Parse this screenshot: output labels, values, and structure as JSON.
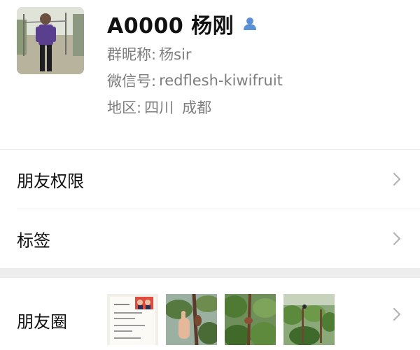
{
  "profile": {
    "display_name": "A0000 杨刚",
    "gender_icon": "male-user-icon",
    "nickname_label": "群昵称:",
    "nickname_value": "杨sir",
    "wechat_label": "微信号:",
    "wechat_value": "redflesh-kiwifruit",
    "region_label": "地区:",
    "region_province": "四川",
    "region_city": "成都"
  },
  "menu": {
    "permission_label": "朋友权限",
    "tags_label": "标签",
    "moments_label": "朋友圈"
  },
  "moments": {
    "thumbnails": [
      "document-photo",
      "kiwi-vine-photo",
      "kiwi-leaves-photo",
      "kiwi-orchard-photo"
    ]
  },
  "colors": {
    "accent_blue": "#5b8fd6",
    "secondary_text": "#7d7d7d",
    "divider": "#ececec",
    "section_gap": "#ededed"
  }
}
